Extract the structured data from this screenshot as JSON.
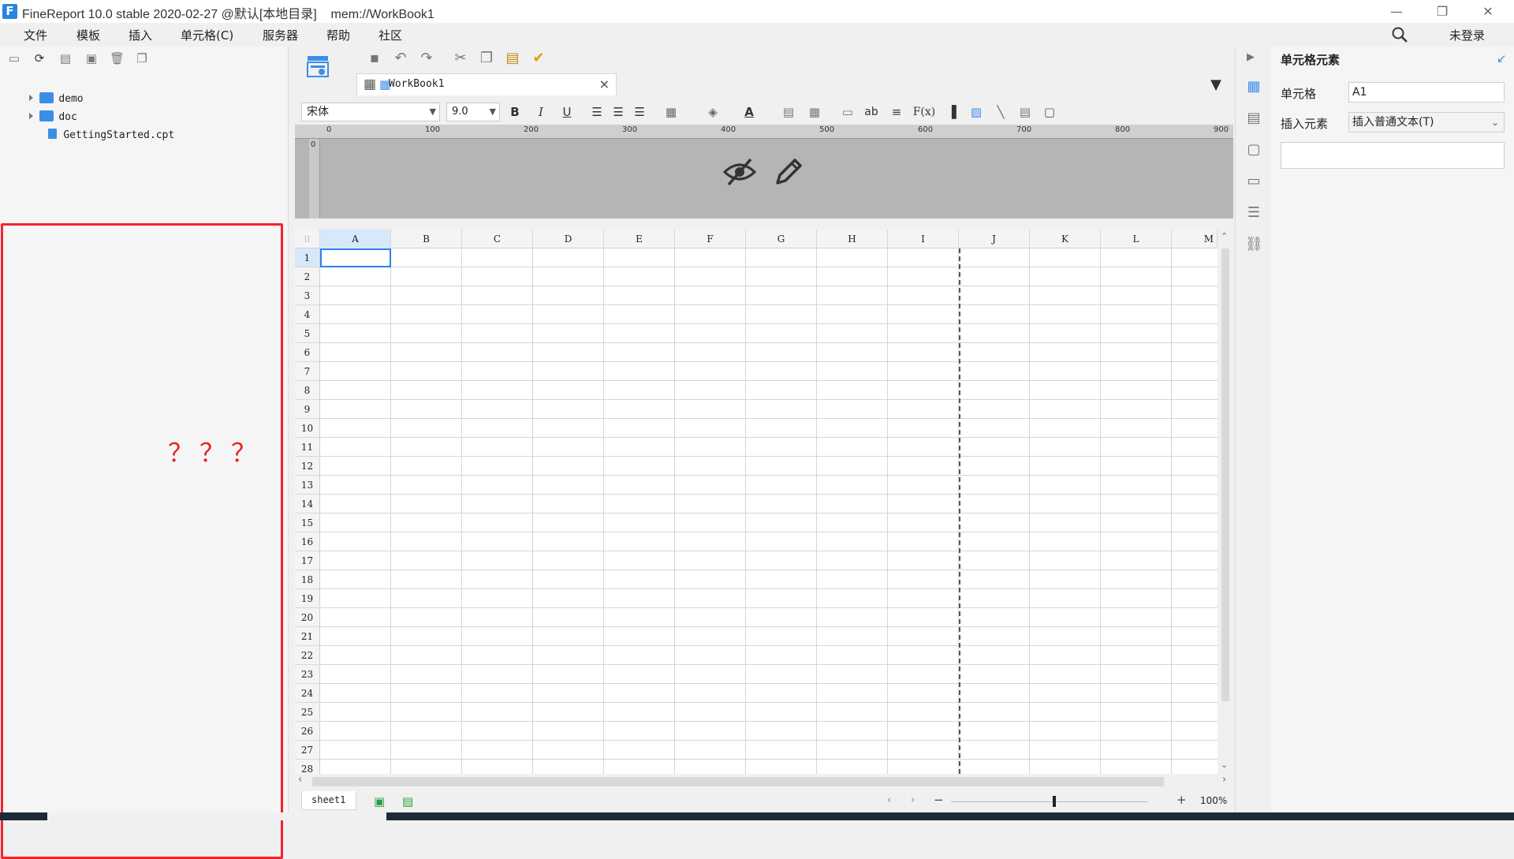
{
  "window": {
    "title": "FineReport 10.0 stable 2020-02-27 @默认[本地目录]    mem://WorkBook1",
    "minimize": "—",
    "restore": "❐",
    "close": "✕"
  },
  "menu": {
    "items": [
      "文件",
      "模板",
      "插入",
      "单元格(C)",
      "服务器",
      "帮助",
      "社区"
    ],
    "login": "未登录"
  },
  "file_tree": {
    "items": [
      {
        "name": "demo",
        "type": "folder"
      },
      {
        "name": "doc",
        "type": "folder"
      },
      {
        "name": "GettingStarted.cpt",
        "type": "file"
      }
    ]
  },
  "annotation": {
    "text": "？？？",
    "color": "#e82323"
  },
  "tab": {
    "name": "WorkBook1",
    "close": "×"
  },
  "format": {
    "font": "宋体",
    "size": "9.0",
    "bold": "B",
    "italic": "I",
    "underline": "U",
    "fx": "F(x)",
    "ab": "ab"
  },
  "ruler": {
    "labels": [
      "0",
      "100",
      "200",
      "300",
      "400",
      "500",
      "600",
      "700",
      "800",
      "900"
    ],
    "vlabel": "0"
  },
  "grid": {
    "columns": [
      "A",
      "B",
      "C",
      "D",
      "E",
      "F",
      "G",
      "H",
      "I",
      "J",
      "K",
      "L",
      "M"
    ],
    "rows": [
      "1",
      "2",
      "3",
      "4",
      "5",
      "6",
      "7",
      "8",
      "9",
      "10",
      "11",
      "12",
      "13",
      "14",
      "15",
      "16",
      "17",
      "18",
      "19",
      "20",
      "21",
      "22",
      "23",
      "24",
      "25",
      "26",
      "27",
      "28"
    ],
    "selected_cell": "A1"
  },
  "sheet": {
    "name": "sheet1",
    "zoom": "100%"
  },
  "right_panel": {
    "title": "单元格元素",
    "cell_label": "单元格",
    "cell_value": "A1",
    "insert_label": "插入元素",
    "insert_value": "插入普通文本(T)"
  },
  "colors": {
    "accent": "#2f80ed",
    "brand": "#2a83de",
    "alert": "#f5222d"
  }
}
